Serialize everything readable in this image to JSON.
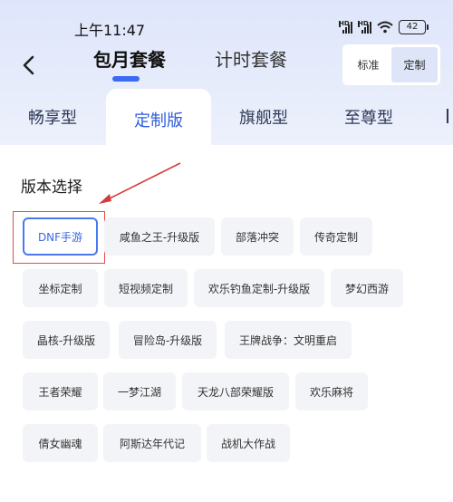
{
  "status_bar": {
    "time": "上午11:47",
    "signal_label_1": "HD",
    "signal_label_2": "HD",
    "battery": "42"
  },
  "header": {
    "tab_monthly": "包月套餐",
    "tab_hourly": "计时套餐",
    "mode_standard": "标准",
    "mode_custom": "定制"
  },
  "plan_tabs": {
    "tab1": "畅享型",
    "tab2": "定制版",
    "tab3": "旗舰型",
    "tab4": "至尊型"
  },
  "version_section": {
    "title": "版本选择",
    "selected": "DNF手游",
    "options": [
      "DNF手游",
      "咸鱼之王-升级版",
      "部落冲突",
      "传奇定制",
      "坐标定制",
      "短视频定制",
      "欢乐钓鱼定制-升级版",
      "梦幻西游",
      "晶核-升级版",
      "冒险岛-升级版",
      "王牌战争：文明重启",
      "王者荣耀",
      "一梦江湖",
      "天龙八部荣耀版",
      "欢乐麻将",
      "倩女幽魂",
      "阿斯达年代记",
      "战机大作战"
    ]
  },
  "colors": {
    "accent": "#3c6bf3",
    "annotation_red": "#e44c4c",
    "chip_bg": "#f3f4f7"
  }
}
